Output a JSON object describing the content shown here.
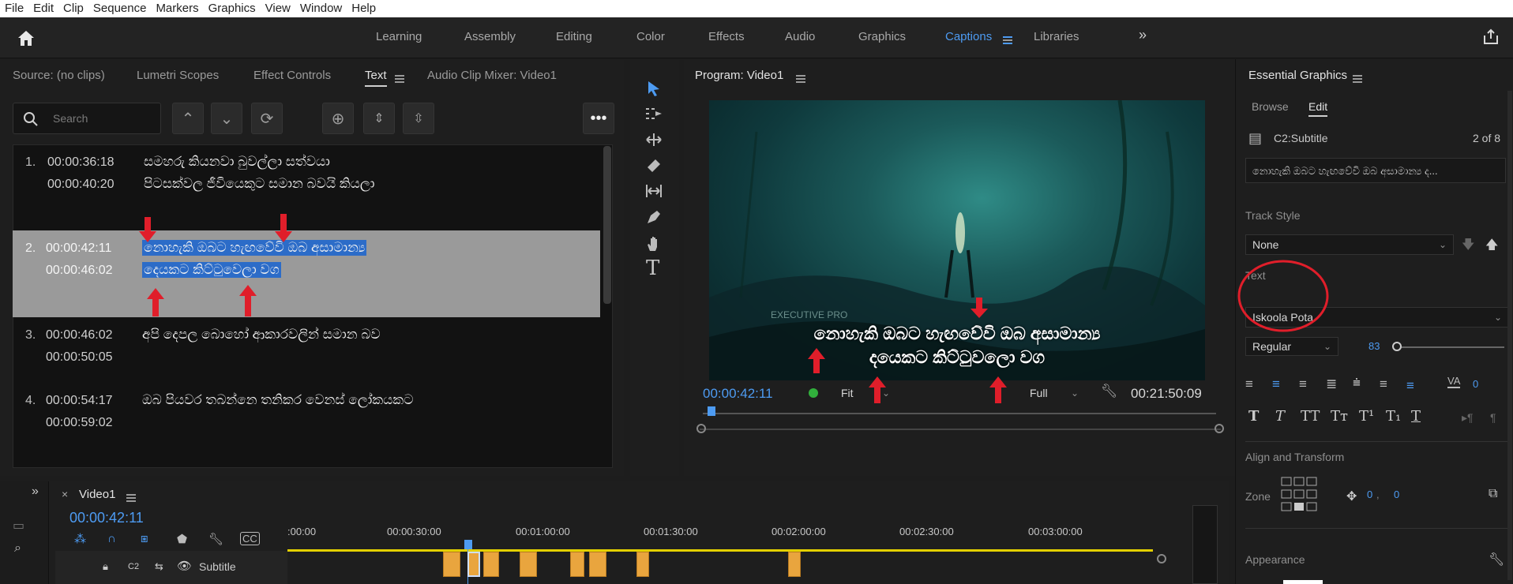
{
  "menu": [
    "File",
    "Edit",
    "Clip",
    "Sequence",
    "Markers",
    "Graphics",
    "View",
    "Window",
    "Help"
  ],
  "workspaces": [
    "Learning",
    "Assembly",
    "Editing",
    "Color",
    "Effects",
    "Audio",
    "Graphics",
    "Captions",
    "Libraries"
  ],
  "workspace_active": "Captions",
  "left_panel": {
    "tabs": [
      "Source: (no clips)",
      "Lumetri Scopes",
      "Effect Controls",
      "Text",
      "Audio Clip Mixer: Video1"
    ],
    "active_tab": "Text",
    "search_placeholder": "Search",
    "captions": [
      {
        "num": "1.",
        "in": "00:00:36:18",
        "out": "00:00:40:20",
        "line1": "සමහරු කියනවා බුවල්ලා සත්වයා",
        "line2": "පිටසක්වල ජීවියෙකුට සමාන බවයි කියලා"
      },
      {
        "num": "2.",
        "in": "00:00:42:11",
        "out": "00:00:46:02",
        "line1": "නොහැකි ඔබට හැඟවේවි ඔබ අසාමාන්‍ය",
        "line2": "දෙයකට කිට්ටුවෙලා වග"
      },
      {
        "num": "3.",
        "in": "00:00:46:02",
        "out": "00:00:50:05",
        "line1": "අපි දෙපල බොහෝ ආකාරවලින් සමාන බව",
        "line2": ""
      },
      {
        "num": "4.",
        "in": "00:00:54:17",
        "out": "00:00:59:02",
        "line1": "ඔබ පියවර තබන්නෙ තනිකර වෙනස් ලෝකයකට",
        "line2": ""
      }
    ]
  },
  "program": {
    "title": "Program: Video1",
    "subtitle_line1": "නොහැකි ඔබට හැඟවේවි ඔබ අසාමාන්‍ය",
    "subtitle_line2": "දයෙකට කිට්ටුවලො වග",
    "watermark": "EXECUTIVE PRO",
    "timecode": "00:00:42:11",
    "fit": "Fit",
    "quality": "Full",
    "duration": "00:21:50:09"
  },
  "essential_graphics": {
    "title": "Essential Graphics",
    "tabs": [
      "Browse",
      "Edit"
    ],
    "active_tab": "Edit",
    "layer": "C2:Subtitle",
    "page": "2 of 8",
    "text_preview": "නොහැකි ඔබට හැඟවේවි ඔබ අසාමාන්‍ය ද...",
    "track_style_label": "Track Style",
    "track_style": "None",
    "text_label": "Text",
    "font": "Iskoola Pota",
    "weight": "Regular",
    "size": "83",
    "tracking": "0",
    "align_label": "Align and Transform",
    "zone_label": "Zone",
    "pos_x": "0",
    "pos_y": "0",
    "appearance_label": "Appearance"
  },
  "timeline": {
    "title": "Video1",
    "timecode": "00:00:42:11",
    "ticks": [
      ":00:00",
      "00:00:30:00",
      "00:01:00:00",
      "00:01:30:00",
      "00:02:00:00",
      "00:02:30:00",
      "00:03:00:00"
    ],
    "track_name": "Subtitle",
    "track_id": "C2"
  },
  "colors": {
    "accent": "#4d9bf2",
    "clip": "#e9a53e",
    "highlight": "#2c6cc8",
    "annotation": "#e01e2a"
  }
}
